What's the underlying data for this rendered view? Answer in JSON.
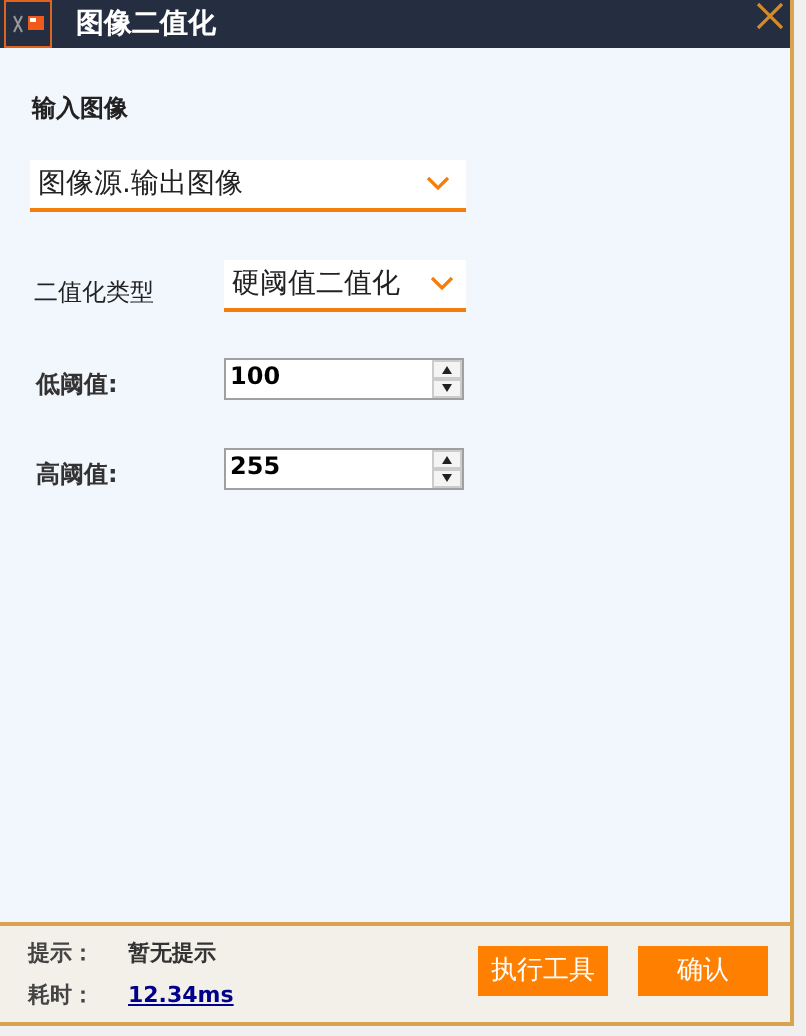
{
  "window": {
    "title": "图像二值化"
  },
  "input_image": {
    "label": "输入图像",
    "value": "图像源.输出图像"
  },
  "binarize_type": {
    "label": "二值化类型",
    "value": "硬阈值二值化"
  },
  "thresholds": [
    {
      "label": "低阈值:",
      "value": "100"
    },
    {
      "label": "高阈值:",
      "value": "255"
    }
  ],
  "footer": {
    "hint_label": "提示：",
    "hint": "暂无提示",
    "time_label": "耗时：",
    "time": "12.34ms"
  },
  "buttons": [
    "执行工具",
    "确认"
  ]
}
